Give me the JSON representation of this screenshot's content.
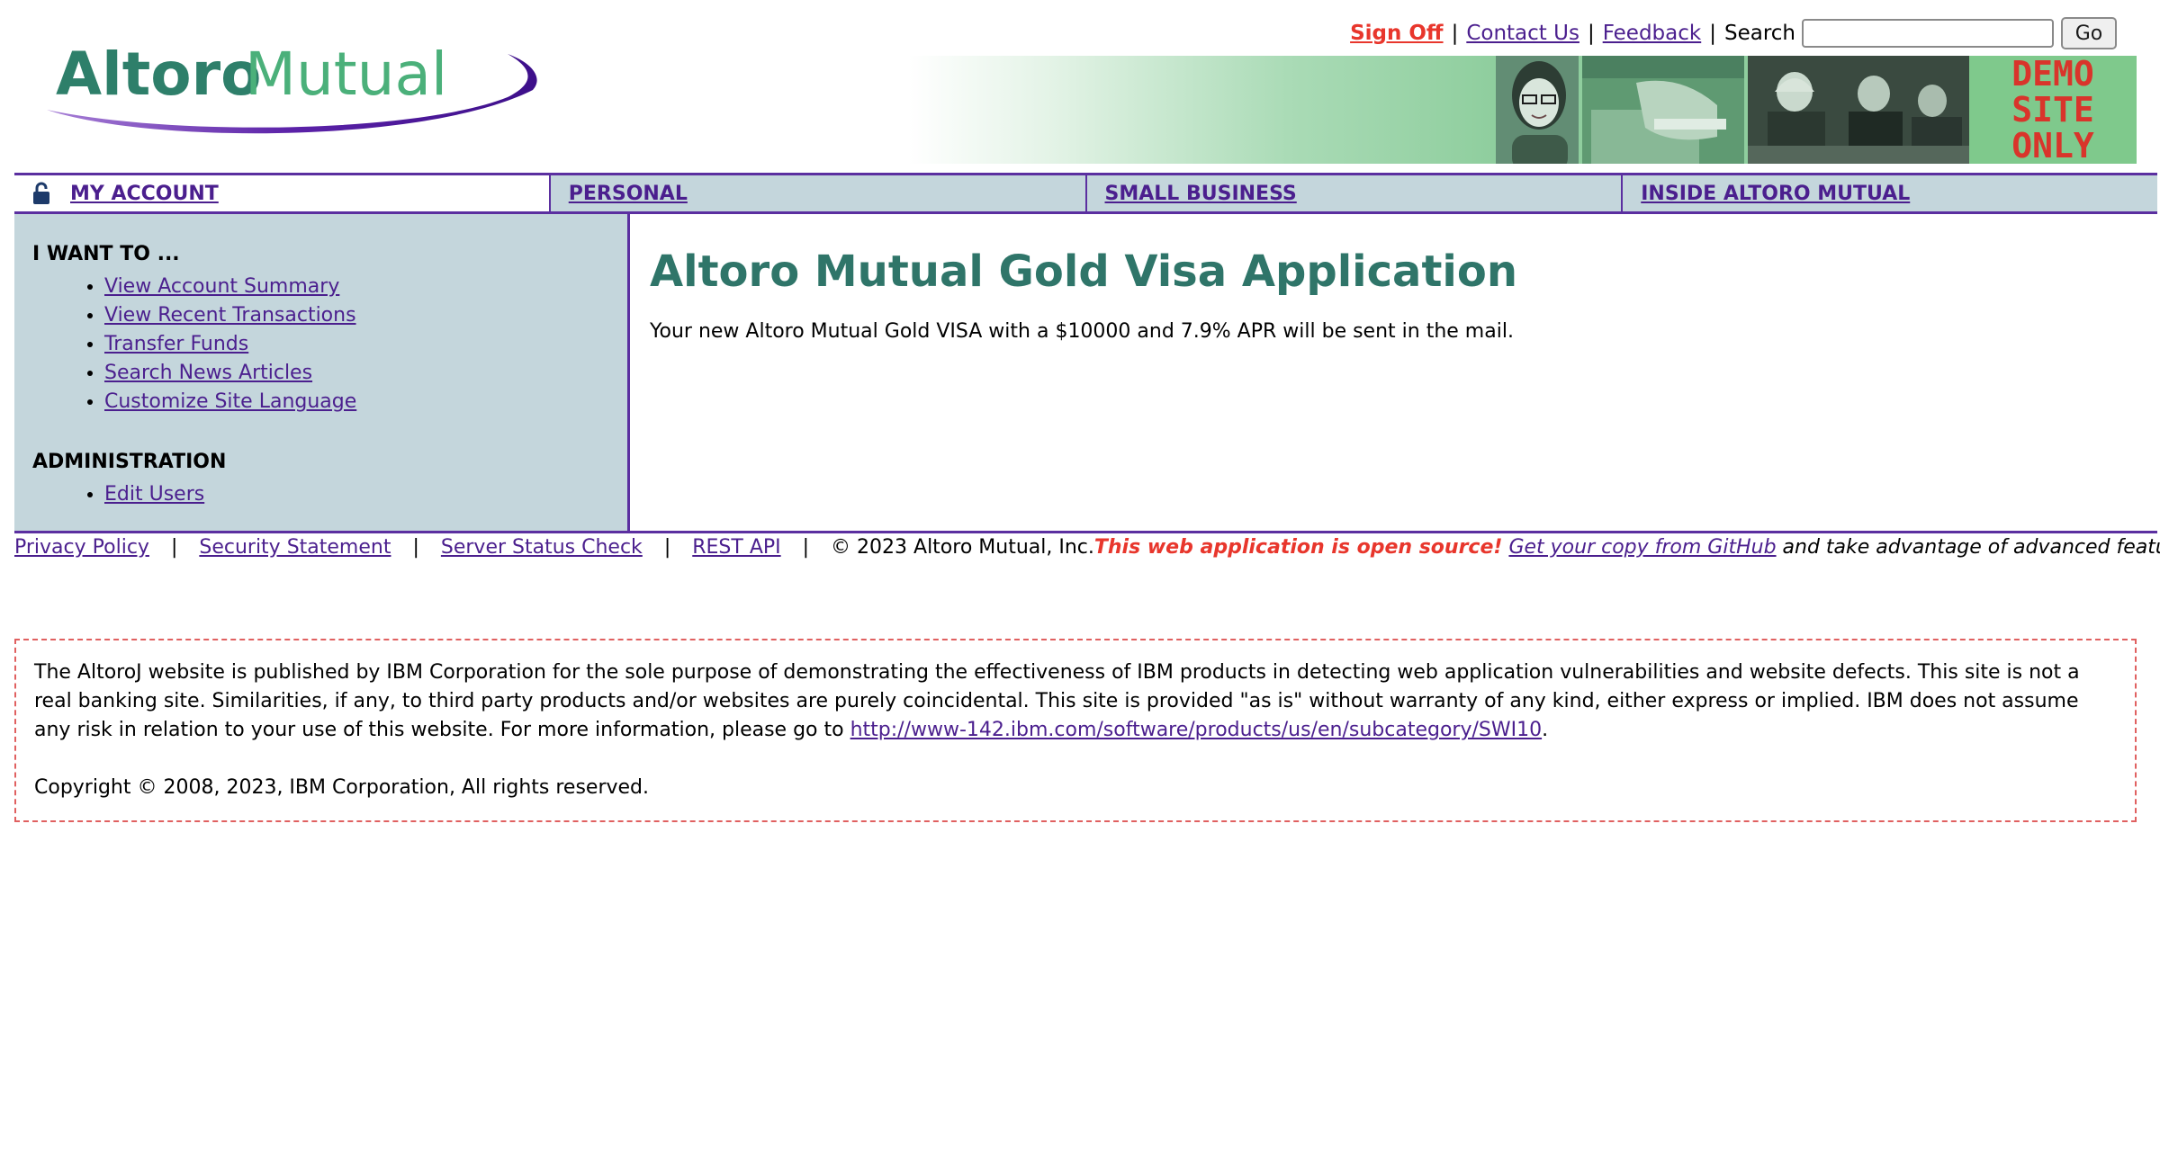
{
  "header": {
    "logo_text_bold": "Altoro",
    "logo_text_light": "Mutual",
    "sign_off": "Sign Off",
    "contact_us": "Contact Us",
    "feedback": "Feedback",
    "separator": "|",
    "search_label": "Search",
    "search_value": "",
    "go_label": "Go",
    "demo_line1": "DEMO",
    "demo_line2": "SITE",
    "demo_line3": "ONLY"
  },
  "nav": {
    "tabs": [
      {
        "label": "MY ACCOUNT",
        "active": true
      },
      {
        "label": "PERSONAL"
      },
      {
        "label": "SMALL BUSINESS"
      },
      {
        "label": "INSIDE ALTORO MUTUAL"
      }
    ]
  },
  "sidebar": {
    "heading_want": "I WANT TO ...",
    "want_items": [
      "View Account Summary",
      "View Recent Transactions",
      "Transfer Funds",
      "Search News Articles",
      "Customize Site Language"
    ],
    "heading_admin": "ADMINISTRATION",
    "admin_items": [
      "Edit Users"
    ]
  },
  "main": {
    "title": "Altoro Mutual Gold Visa Application",
    "message": "Your new Altoro Mutual Gold VISA with a $10000 and 7.9% APR will be sent in the mail."
  },
  "footer": {
    "privacy": "Privacy Policy",
    "security": "Security Statement",
    "status": "Server Status Check",
    "rest": "REST API",
    "copyright": "© 2023 Altoro Mutual, Inc.",
    "open_source": "This web application is open source!",
    "github": "Get your copy from GitHub",
    "advantage": "and take advantage of advanced features"
  },
  "disclaimer": {
    "text1": "The AltoroJ website is published by IBM Corporation for the sole purpose of demonstrating the effectiveness of IBM products in detecting web application vulnerabilities and website defects. This site is not a real banking site. Similarities, if any, to third party products and/or websites are purely coincidental. This site is provided \"as is\" without warranty of any kind, either express or implied. IBM does not assume any risk in relation to your use of this website. For more information, please go to",
    "link": "http://www-142.ibm.com/software/products/us/en/subcategory/SWI10",
    "end": ".",
    "copyright": "Copyright © 2008, 2023, IBM Corporation, All rights reserved."
  },
  "colors": {
    "accent_purple": "#5b2fa0",
    "link": "#4b1f8e",
    "title_green": "#2f7569",
    "nav_bg": "#c4d6dc",
    "signoff_red": "#e8362c"
  }
}
